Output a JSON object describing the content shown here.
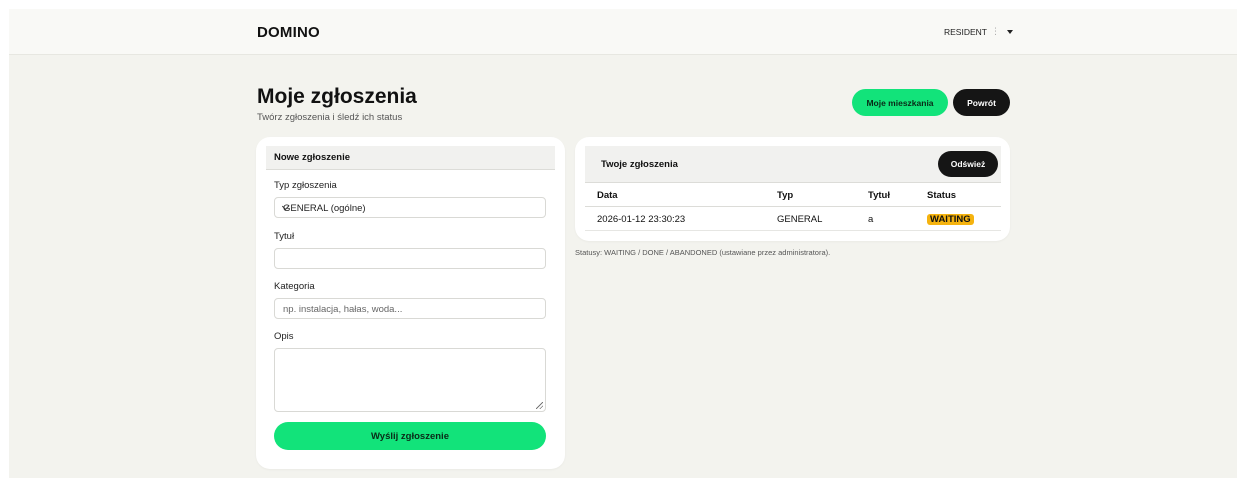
{
  "navbar": {
    "brand": "DOMINO",
    "user_label": "RESIDENT",
    "user_separator": "⋮"
  },
  "header": {
    "title": "Moje zgłoszenia",
    "subtitle": "Twórz zgłoszenia i śledź ich status",
    "btn_apartments": "Moje mieszkania",
    "btn_back": "Powrót"
  },
  "form": {
    "header": "Nowe zgłoszenie",
    "type_label": "Typ zgłoszenia",
    "type_value": "GENERAL (ogólne)",
    "title_label": "Tytuł",
    "title_value": "",
    "category_label": "Kategoria",
    "category_placeholder": "np. instalacja, hałas, woda...",
    "description_label": "Opis",
    "submit_label": "Wyślij zgłoszenie"
  },
  "list": {
    "header": "Twoje zgłoszenia",
    "refresh_label": "Odśwież",
    "columns": [
      "Data",
      "Typ",
      "Tytuł",
      "Status"
    ],
    "rows": [
      {
        "date": "2026-01-12 23:30:23",
        "type": "GENERAL",
        "title": "a",
        "status": "WAITING"
      }
    ],
    "status_note": "Statusy: WAITING / DONE / ABANDONED (ustawiane przez administratora)."
  },
  "colors": {
    "accent_green": "#12e37a",
    "dark_button": "#151515",
    "badge_waiting": "#f5b30f",
    "page_bg": "#f3f3ee"
  }
}
